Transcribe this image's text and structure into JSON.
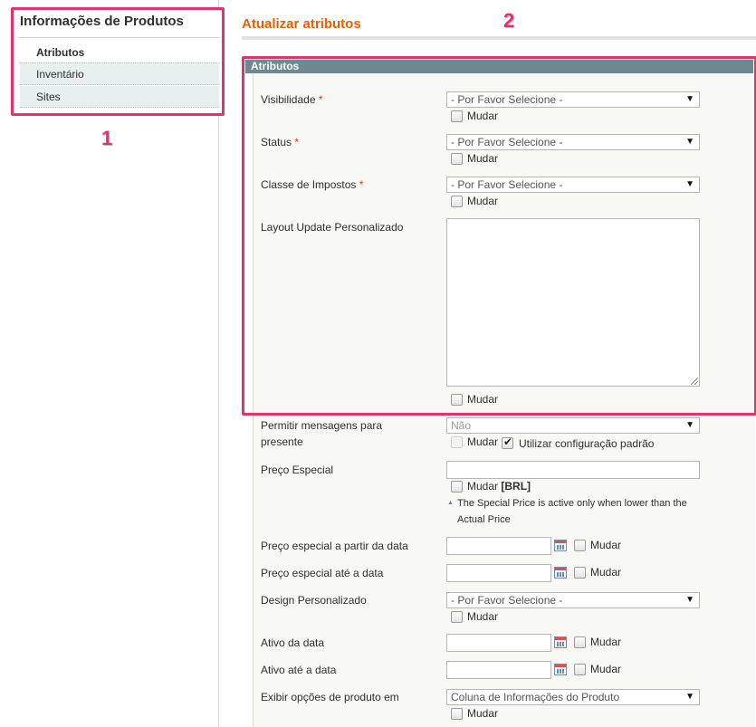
{
  "sidebar": {
    "title": "Informações de Produtos",
    "items": [
      {
        "label": "Atributos"
      },
      {
        "label": "Inventário"
      },
      {
        "label": "Sites"
      }
    ],
    "badge": "1"
  },
  "main": {
    "title": "Atualizar atributos",
    "badge": "2",
    "section_title": "Atributos",
    "change_label": "Mudar",
    "fields": {
      "visibilidade": {
        "label": "Visibilidade",
        "value": "- Por Favor Selecione -"
      },
      "status": {
        "label": "Status",
        "value": "- Por Favor Selecione -"
      },
      "classe_impostos": {
        "label": "Classe de Impostos",
        "value": "- Por Favor Selecione -"
      },
      "layout_update": {
        "label": "Layout Update Personalizado"
      },
      "mensagens_presente": {
        "label": "Permitir mensagens para presente",
        "value": "Não",
        "use_default_label": "Utilizar configuração padrão"
      },
      "preco_especial": {
        "label": "Preço Especial",
        "change_label": "Mudar",
        "currency": "[BRL]",
        "note": "The Special Price is active only when lower than the Actual Price"
      },
      "preco_especial_de": {
        "label": "Preço especial a partir da data"
      },
      "preco_especial_ate": {
        "label": "Preço especial até a data"
      },
      "design_personalizado": {
        "label": "Design Personalizado",
        "value": "- Por Favor Selecione -"
      },
      "ativo_da_data": {
        "label": "Ativo da data"
      },
      "ativo_ate_data": {
        "label": "Ativo até a data"
      },
      "exibir_opcoes": {
        "label": "Exibir opções de produto em",
        "value": "Coluna de Informações do Produto"
      }
    },
    "required_mark": "*"
  },
  "colors": {
    "accent": "#eb5e00",
    "highlight": "#e4326e",
    "section_head": "#6f8992"
  }
}
